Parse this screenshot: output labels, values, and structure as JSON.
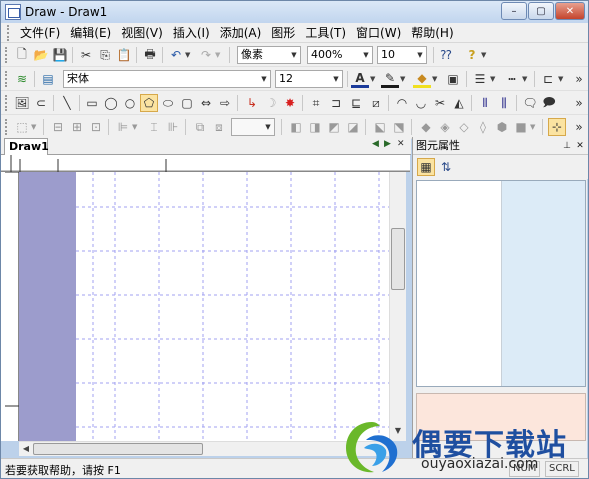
{
  "window": {
    "title": "Draw - Draw1",
    "controls": [
      "–",
      "▢",
      "✕"
    ]
  },
  "menu": [
    "文件(F)",
    "编辑(E)",
    "视图(V)",
    "插入(I)",
    "添加(A)",
    "图形",
    "工具(T)",
    "窗口(W)",
    "帮助(H)"
  ],
  "toolbar1": {
    "unit": "像素",
    "zoom": "400%",
    "size": "10"
  },
  "toolbar2": {
    "font": "宋体",
    "font_size": "12"
  },
  "document": {
    "tab": "Draw1"
  },
  "panel": {
    "title": "图元属性"
  },
  "status": {
    "help_text": "若要获取帮助，请按 F1",
    "num": "NUM",
    "scrl": "SCRL"
  },
  "watermark": {
    "cn": "偶要下载站",
    "en": "ouyaoxiazai.com"
  },
  "colors": {
    "page_shade": "#9c9ccc",
    "grid_line": "#a0a0f0",
    "prop_bg": "#dcebf7",
    "desc_bg": "#fce6dc"
  }
}
